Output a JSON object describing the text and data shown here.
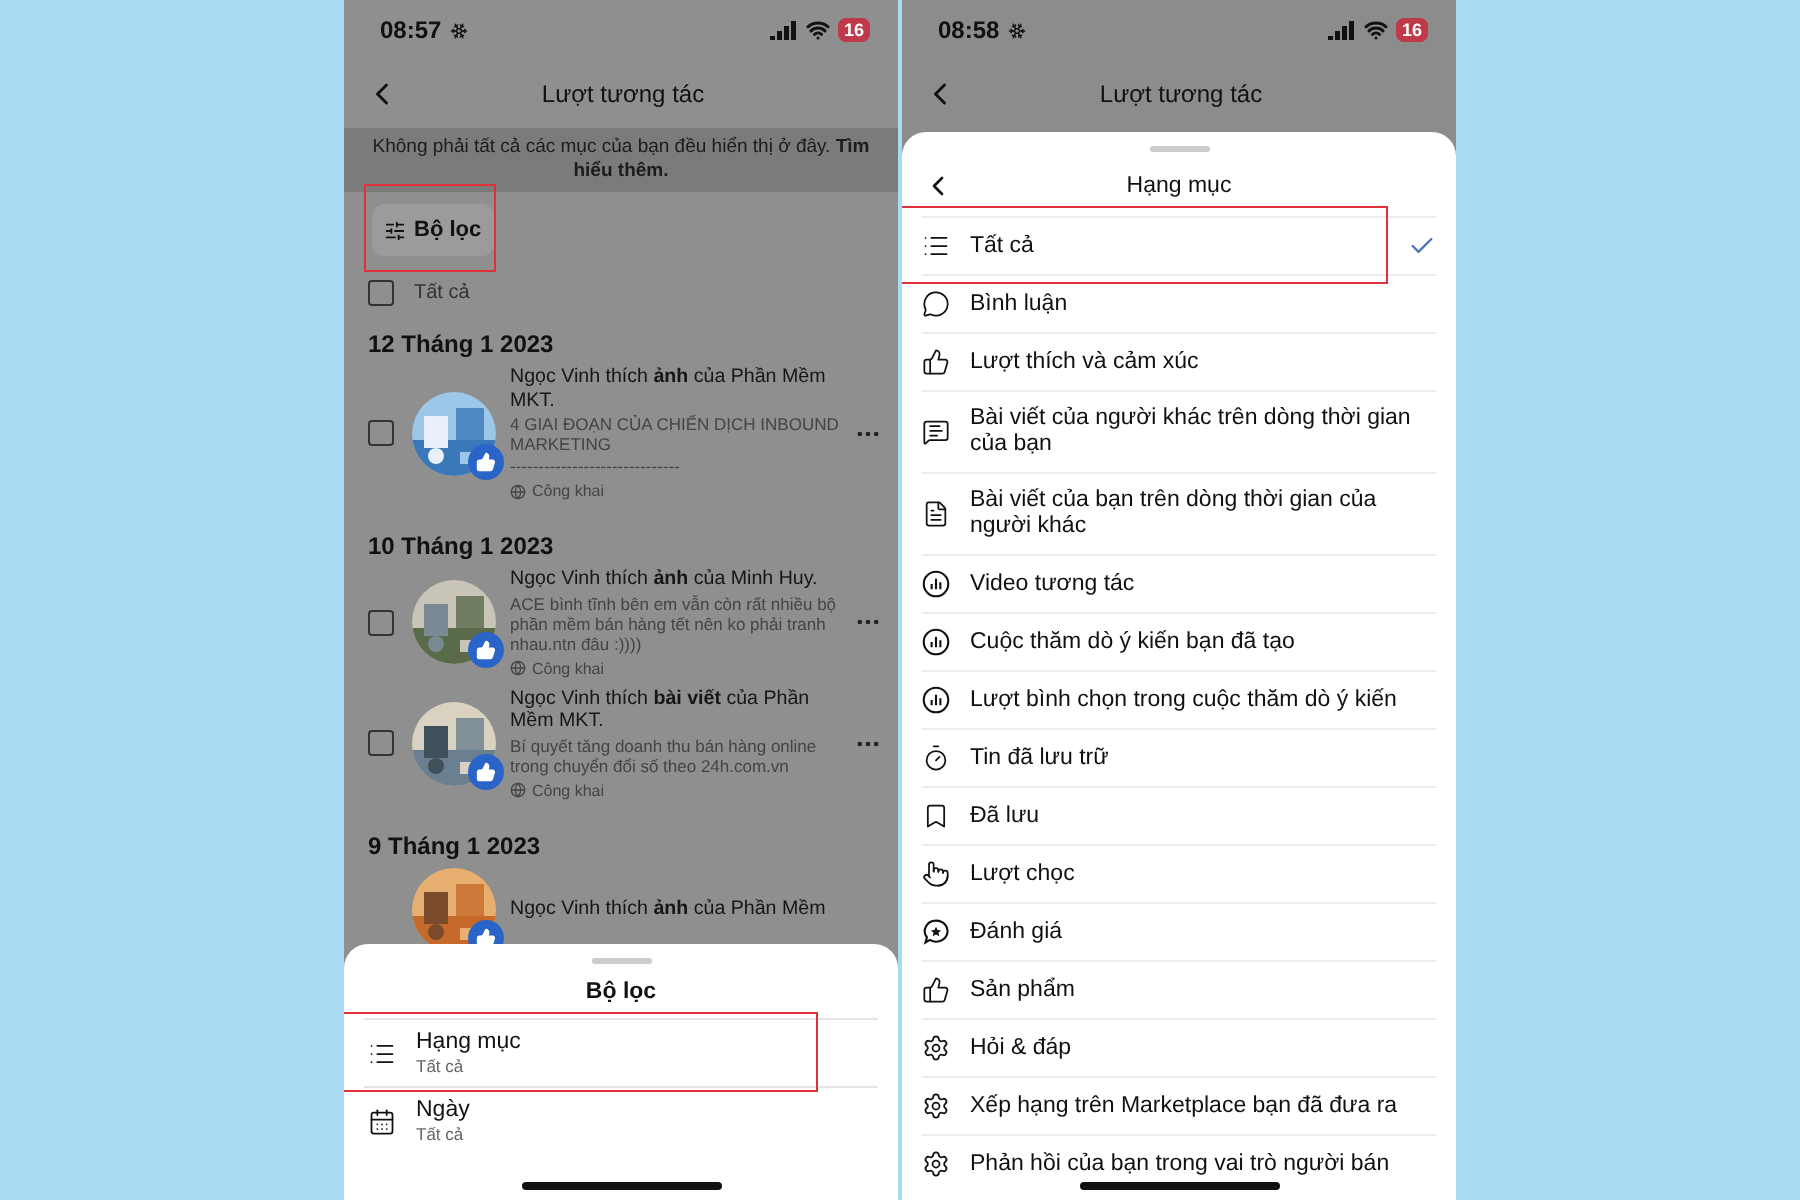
{
  "left_screen": {
    "status_bar": {
      "time": "08:57",
      "battery": "16"
    },
    "header": {
      "title": "Lượt tương tác"
    },
    "notice": "Không phải tất cả các mục của bạn đều hiển thị ở đây. **Tìm hiểu thêm.**",
    "filter_button": "Bộ lọc",
    "select_all": {
      "label": "Tất cả",
      "checked": false
    },
    "groups": [
      {
        "date": "12 Tháng 1 2023",
        "items": [
          {
            "title": "Ngọc Vinh thích **ảnh** của Phần Mềm MKT.",
            "excerpt": "4 GIAI ĐOẠN CỦA CHIẾN DỊCH INBOUND MARKETING",
            "note": "------------------------------",
            "privacy": "Công khai",
            "checked": false
          }
        ]
      },
      {
        "date": "10 Tháng 1 2023",
        "items": [
          {
            "title": "Ngọc Vinh thích **ảnh** của Minh Huy.",
            "excerpt": "ACE bình tĩnh bên em vẫn còn rất nhiều bộ phần mềm bán hàng tết nên ko phải tranh nhau.ntn đâu :))))",
            "privacy": "Công khai",
            "checked": false
          },
          {
            "title": "Ngọc Vinh thích **bài viết** của Phần Mềm MKT.",
            "excerpt": "Bí quyết tăng doanh thu bán hàng online trong chuyển đổi số theo 24h.com.vn",
            "privacy": "Công khai",
            "checked": false
          }
        ]
      },
      {
        "date": "9 Tháng 1 2023",
        "items": [
          {
            "title": "Ngọc Vinh thích **ảnh** của Phần Mềm"
          }
        ]
      }
    ],
    "filter_sheet": {
      "title": "Bộ lọc",
      "options": [
        {
          "label": "Hạng mục",
          "value": "Tất cả"
        },
        {
          "label": "Ngày",
          "value": "Tất cả"
        }
      ]
    }
  },
  "right_screen": {
    "status_bar": {
      "time": "08:58",
      "battery": "16"
    },
    "header": {
      "title": "Lượt tương tác"
    },
    "category_sheet": {
      "title": "Hạng mục",
      "items": [
        {
          "label": "Tất cả",
          "selected": true
        },
        {
          "label": "Bình luận",
          "selected": false
        },
        {
          "label": "Lượt thích và cảm xúc",
          "selected": false
        },
        {
          "label": "Bài viết của người khác trên dòng thời gian của bạn",
          "selected": false
        },
        {
          "label": "Bài viết của bạn trên dòng thời gian của người khác",
          "selected": false
        },
        {
          "label": "Video tương tác",
          "selected": false
        },
        {
          "label": "Cuộc thăm dò ý kiến bạn đã tạo",
          "selected": false
        },
        {
          "label": "Lượt bình chọn trong cuộc thăm dò ý kiến",
          "selected": false
        },
        {
          "label": "Tin đã lưu trữ",
          "selected": false
        },
        {
          "label": "Đã lưu",
          "selected": false
        },
        {
          "label": "Lượt chọc",
          "selected": false
        },
        {
          "label": "Đánh giá",
          "selected": false
        },
        {
          "label": "Sản phẩm",
          "selected": false
        },
        {
          "label": "Hỏi & đáp",
          "selected": false
        },
        {
          "label": "Xếp hạng trên Marketplace bạn đã đưa ra",
          "selected": false
        },
        {
          "label": "Phản hồi của bạn trong vai trò người bán",
          "selected": false
        }
      ]
    }
  }
}
